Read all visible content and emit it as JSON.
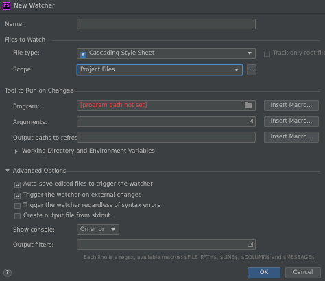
{
  "window": {
    "title": "New Watcher",
    "icon_text": "PS"
  },
  "name": {
    "label": "Name:",
    "value": ""
  },
  "files_to_watch": {
    "section": "Files to Watch",
    "file_type_label": "File type:",
    "file_type_value": "Cascading Style Sheet",
    "file_type_icon": "css-file-icon",
    "track_only_root": "Track only root files",
    "scope_label": "Scope:",
    "scope_value": "Project Files",
    "scope_more": "..."
  },
  "tool": {
    "section": "Tool to Run on Changes",
    "program_label": "Program:",
    "program_value": "[program path not set]",
    "arguments_label": "Arguments:",
    "output_paths_label": "Output paths to refresh:",
    "insert_macro": "Insert Macro...",
    "working_dir": "Working Directory and Environment Variables"
  },
  "advanced": {
    "section": "Advanced Options",
    "options": [
      {
        "label": "Auto-save edited files to trigger the watcher",
        "checked": true
      },
      {
        "label": "Trigger the watcher on external changes",
        "checked": true
      },
      {
        "label": "Trigger the watcher regardless of syntax errors",
        "checked": false
      },
      {
        "label": "Create output file from stdout",
        "checked": false
      }
    ],
    "show_console_label": "Show console:",
    "show_console_value": "On error",
    "output_filters_label": "Output filters:",
    "hint": "Each line is a regex, available macros: $FILE_PATH$, $LINE$, $COLUMN$ and $MESSAGE$"
  },
  "footer": {
    "help": "?",
    "ok": "OK",
    "cancel": "Cancel"
  },
  "colors": {
    "accent": "#4a88c7",
    "error": "#e04a4a",
    "primary_button": "#365880"
  }
}
